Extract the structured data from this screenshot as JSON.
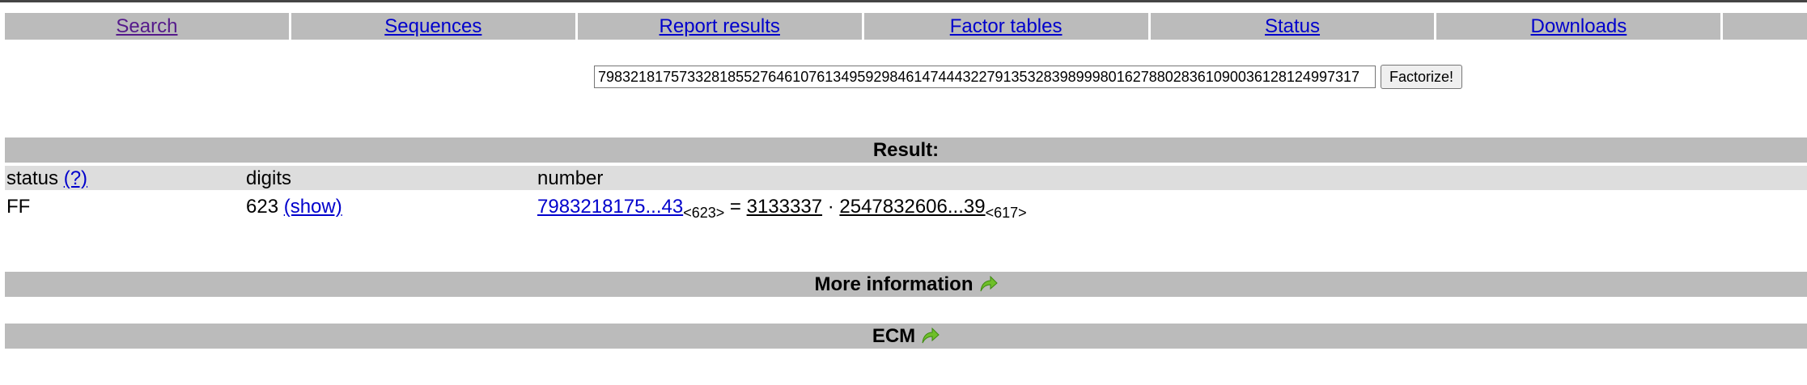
{
  "nav": {
    "items": [
      {
        "label": "Search"
      },
      {
        "label": "Sequences"
      },
      {
        "label": "Report results"
      },
      {
        "label": "Factor tables"
      },
      {
        "label": "Status"
      },
      {
        "label": "Downloads"
      },
      {
        "label": ""
      }
    ]
  },
  "search": {
    "value": "7983218175733281855276461076134959298461474443227913532839899980162788028361090036128124997317",
    "button_label": "Factorize!"
  },
  "result": {
    "title": "Result:",
    "headers": {
      "status": "status",
      "status_help": "(?)",
      "digits": "digits",
      "number": "number"
    },
    "row": {
      "status": "FF",
      "digits": "623",
      "show": "(show)",
      "number": "7983218175...43",
      "number_len": "<623>",
      "equals": "=",
      "factor1": "3133337",
      "dot": "·",
      "factor2": "2547832606...39",
      "factor2_len": "<617>"
    }
  },
  "more_info": {
    "title": "More information"
  },
  "ecm": {
    "title": "ECM"
  },
  "colors": {
    "bar_gray": "#bbbbbb",
    "header_gray": "#dddddd",
    "link_blue": "#0000cc",
    "link_visited": "#551a8b",
    "arrow_green": "#6fbf2a"
  }
}
